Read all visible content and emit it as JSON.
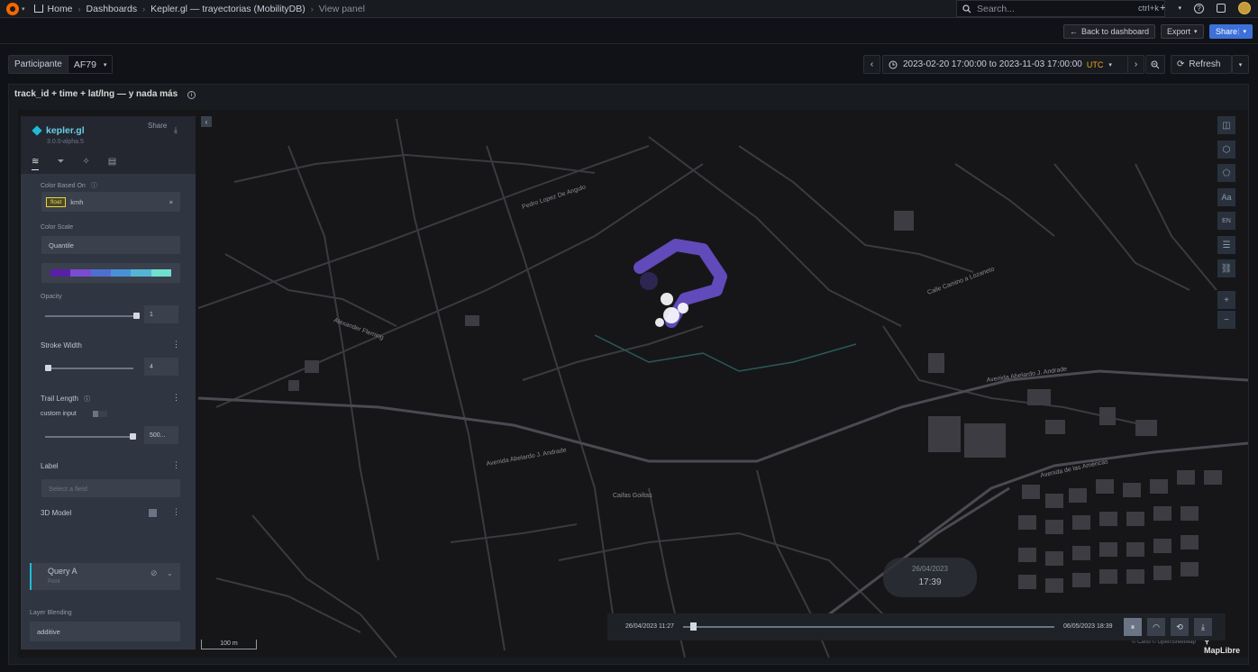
{
  "topbar": {
    "breadcrumb": [
      "Home",
      "Dashboards",
      "Kepler.gl — trayectorias (MobilityDB)",
      "View panel"
    ],
    "search_placeholder": "Search...",
    "search_shortcut": "ctrl+k",
    "plus_label": "+"
  },
  "toolbar": {
    "back_label": "Back to dashboard",
    "export_label": "Export",
    "share_label": "Share"
  },
  "variables": {
    "participant_label": "Participante",
    "participant_value": "AF79"
  },
  "timepicker": {
    "range": "2023-02-20 17:00:00 to 2023-11-03 17:00:00",
    "tz": "UTC",
    "refresh_label": "Refresh"
  },
  "panel": {
    "title": "track_id + time + lat/lng — y nada más"
  },
  "kepler": {
    "brand": "kepler.gl",
    "version": "3.0.0-alpha.5",
    "share": "Share",
    "color_based_on_label": "Color Based On",
    "field_type": "float",
    "field_name": "kmh",
    "color_scale_label": "Color Scale",
    "color_scale_value": "Quantile",
    "palette": [
      "#5a1fa8",
      "#7a4cd1",
      "#4f6fd0",
      "#4a90d8",
      "#55b4d6",
      "#6fe0d0"
    ],
    "opacity_label": "Opacity",
    "opacity_value": "1",
    "opacity_level": 1.0,
    "stroke_width_label": "Stroke Width",
    "stroke_width_value": "4",
    "trail_length_label": "Trail Length",
    "custom_input_label": "custom input",
    "trail_length_value": "500...",
    "label_label": "Label",
    "label_placeholder": "Select a field",
    "model_label": "3D Model",
    "query_label": "Query A",
    "query_type": "Point",
    "blending_label": "Layer Blending",
    "blending_value": "additive",
    "scale_label": "100 m"
  },
  "timeline": {
    "start": "26/04/2023 11:27",
    "end": "06/05/2023 18:39",
    "current_date": "26/04/2023",
    "current_time": "17:39",
    "position": 0.02
  },
  "map": {
    "attribution": "© Carto © OpenStreetMap",
    "maplibre": "MapLibre",
    "street_labels": [
      "Avenida Abelardo J. Andrade",
      "Avenida de las Américas",
      "Alexander Fleming",
      "Pedro Lopez De Angulo",
      "Calle Camino a Lozaneto",
      "Avenida Abelardo J. Andrade",
      "Caifas Goiltas"
    ]
  },
  "colors": {
    "accent": "#3d71d9",
    "trajectory": "#7b5cf0",
    "brand": "#1fbad6"
  }
}
